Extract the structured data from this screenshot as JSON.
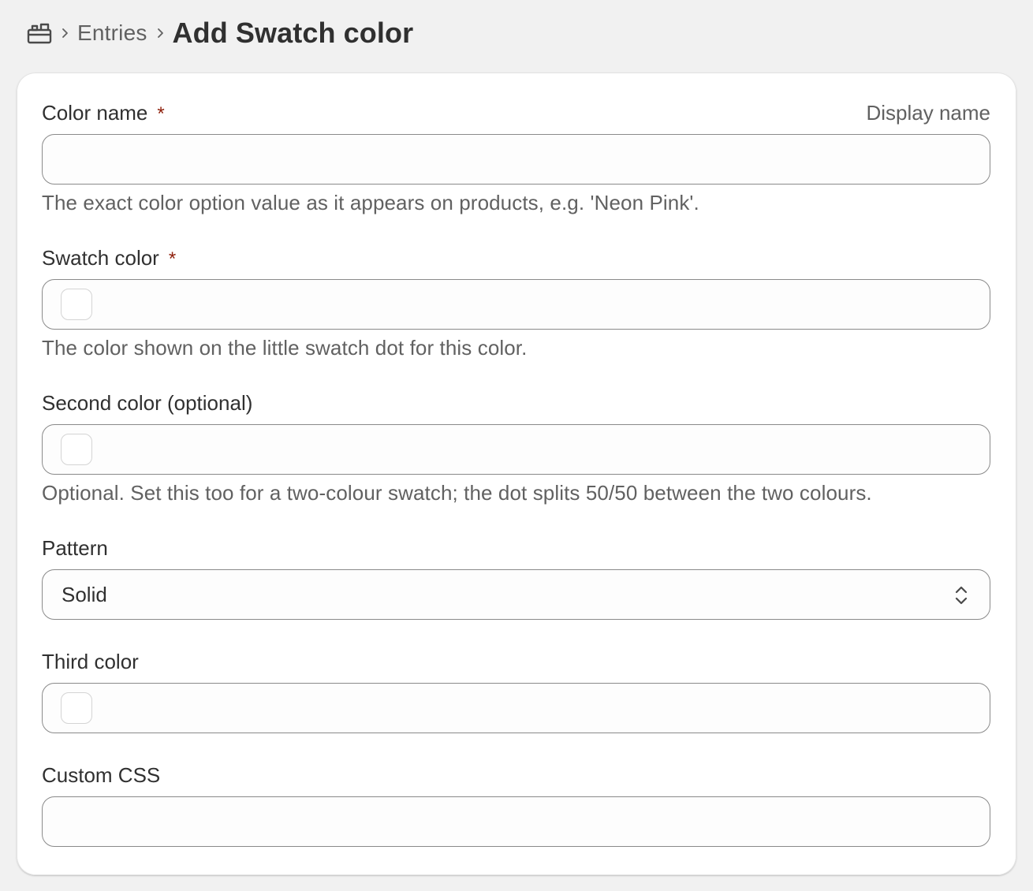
{
  "breadcrumb": {
    "home_icon": "store-icon",
    "entries": "Entries",
    "separator_icon": "chevron-right-icon"
  },
  "page": {
    "title": "Add Swatch color"
  },
  "form": {
    "color_name": {
      "label": "Color name",
      "required_mark": "*",
      "aside": "Display name",
      "value": "",
      "help": "The exact color option value as it appears on products, e.g. 'Neon Pink'."
    },
    "swatch_color": {
      "label": "Swatch color",
      "required_mark": "*",
      "help": "The color shown on the little swatch dot for this color."
    },
    "second_color": {
      "label": "Second color (optional)",
      "help": "Optional. Set this too for a two-colour swatch; the dot splits 50/50 between the two colours."
    },
    "pattern": {
      "label": "Pattern",
      "selected": "Solid",
      "icon": "select-chevron-updown-icon"
    },
    "third_color": {
      "label": "Third color"
    },
    "custom_css": {
      "label": "Custom CSS",
      "value": ""
    }
  },
  "colors": {
    "required": "#8e1f0b",
    "text": "#303030",
    "subdued": "#616161",
    "border": "#8a8a8a",
    "background": "#f1f1f1"
  }
}
